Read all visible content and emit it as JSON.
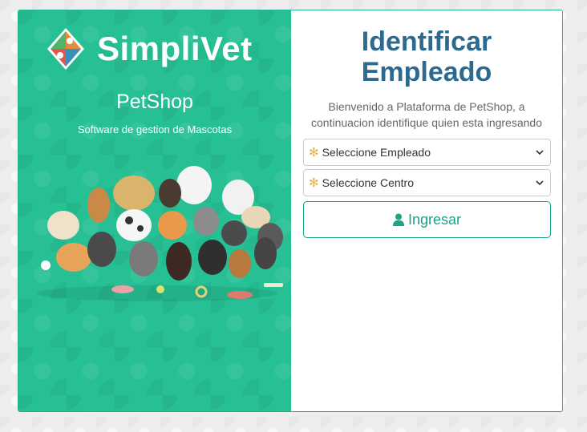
{
  "brand": {
    "name": "SimpliVet",
    "product": "PetShop",
    "tagline": "Software de gestion de Mascotas"
  },
  "form": {
    "title_line1": "Identificar",
    "title_line2": "Empleado",
    "welcome": "Bienvenido a Plataforma de PetShop, a continuacion identifique quien esta ingresando",
    "employee_select": "Seleccione Empleado",
    "center_select": "Seleccione Centro",
    "submit_label": "Ingresar"
  },
  "colors": {
    "brand_green": "#27c095",
    "title_blue": "#2c6b8f",
    "button_green": "#1aa587"
  },
  "icons": [
    "logo-icon",
    "paw-icon",
    "chevron-down-icon",
    "user-icon",
    "dogs-illustration"
  ]
}
